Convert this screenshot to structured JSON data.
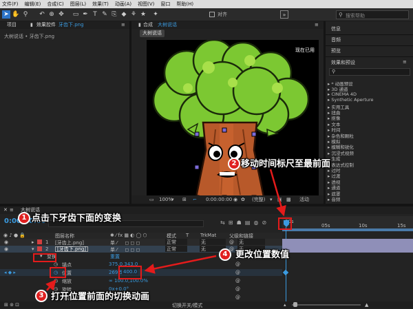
{
  "menu": [
    "文件(F)",
    "编辑(E)",
    "合成(C)",
    "图层(L)",
    "效果(T)",
    "动画(A)",
    "视图(V)",
    "窗口",
    "帮助(H)"
  ],
  "toolbar": {
    "snap_label": "对齐",
    "search_placeholder": "搜索帮助"
  },
  "project_panel": {
    "tab": "项目",
    "effects_tab": "效果控件",
    "effects_layer": "牙齿下.png",
    "breadcrumb": "大树说话 • 牙齿下.png"
  },
  "comp_panel": {
    "tab": "合成",
    "comp_name": "大树说话",
    "comp_chip": "大树说话",
    "watermark": "现在已用",
    "zoom": "100%",
    "timecode": "0:00:00:00",
    "quality": "(完整)",
    "active_camera": "活动"
  },
  "right_panel": {
    "items": [
      "信息",
      "音频",
      "预览"
    ],
    "effects_title": "效果和预设",
    "search_placeholder": "",
    "categories": [
      "* 动画预设",
      "3D 通道",
      "CINEMA 4D",
      "Synthetic Aperture",
      "实用工具",
      "扭曲",
      "抠像",
      "文本",
      "时间",
      "杂色和颗粒",
      "模拟",
      "模糊和锐化",
      "沉浸式视频",
      "生成",
      "表达式控制",
      "过时",
      "过渡",
      "透视",
      "通道",
      "遮罩",
      "音频"
    ]
  },
  "timeline": {
    "tab": "大树说话",
    "timecode": "0:00:00:00",
    "col_layer": "图层名称",
    "col_mode": "模式",
    "col_trkmat": "TrkMat",
    "col_parent": "父级和链接",
    "ruler": [
      "00s",
      "05s",
      "10s",
      "15s"
    ],
    "layers": [
      {
        "num": "1",
        "name": "[牙齿上.png]",
        "mode": "正常",
        "trk": "无"
      },
      {
        "num": "2",
        "name": "[牙齿下.png]",
        "mode": "正常",
        "trk": "无"
      }
    ],
    "transform_label": "变换",
    "reset_label": "重置",
    "anchor_label": "锚点",
    "anchor_value": "375.0,343.0",
    "position_label": "位置",
    "position_x": "269.5,",
    "position_y": "400.0",
    "scale_label": "缩放",
    "rotation_label": "旋转",
    "scale_value": "∞ 100.0,100.0%",
    "rotation_value": "0x+0.0°",
    "opacity_label": "不透明度",
    "opacity_value": "100%",
    "switch_label": "切换开关/模式"
  },
  "annotations": [
    {
      "num": "1",
      "text": "点击下牙齿下面的变换"
    },
    {
      "num": "2",
      "text": "移动时间标尺至最前面"
    },
    {
      "num": "3",
      "text": "打开位置前面的切换动画"
    },
    {
      "num": "4",
      "text": "更改位置数值"
    }
  ],
  "colors": {
    "accent": "#2d74c7",
    "annotation_red": "#e02020",
    "tree_green": "#7cc832",
    "tree_trunk": "#b8592a"
  }
}
